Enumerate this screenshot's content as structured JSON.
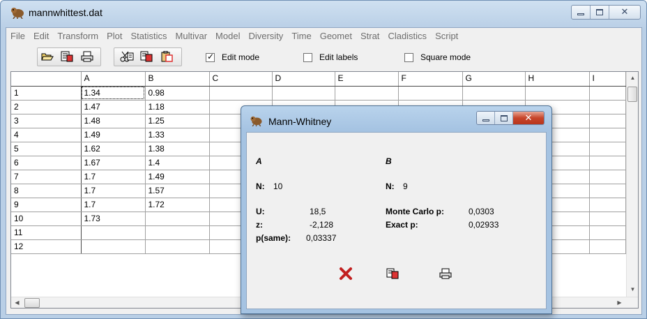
{
  "window": {
    "title": "mannwhittest.dat"
  },
  "menu": [
    "File",
    "Edit",
    "Transform",
    "Plot",
    "Statistics",
    "Multivar",
    "Model",
    "Diversity",
    "Time",
    "Geomet",
    "Strat",
    "Cladistics",
    "Script"
  ],
  "toolbar": {
    "edit_mode": {
      "label": "Edit mode",
      "checked": true
    },
    "edit_labels": {
      "label": "Edit labels",
      "checked": false
    },
    "square_mode": {
      "label": "Square mode",
      "checked": false
    }
  },
  "grid": {
    "columns": [
      "A",
      "B",
      "C",
      "D",
      "E",
      "F",
      "G",
      "H",
      "I"
    ],
    "row_labels": [
      "1",
      "2",
      "3",
      "4",
      "5",
      "6",
      "7",
      "8",
      "9",
      "10",
      "11",
      "12"
    ],
    "col_a": [
      "1.34",
      "1.47",
      "1.48",
      "1.49",
      "1.62",
      "1.67",
      "1.7",
      "1.7",
      "1.7",
      "1.73",
      "",
      ""
    ],
    "col_b": [
      "0.98",
      "1.18",
      "1.25",
      "1.33",
      "1.38",
      "1.4",
      "1.49",
      "1.57",
      "1.72",
      "",
      "",
      ""
    ]
  },
  "dialog": {
    "title": "Mann-Whitney",
    "group_a": "A",
    "group_b": "B",
    "n_label": "N:",
    "n_a": "10",
    "n_b": "9",
    "u_label": "U:",
    "u_value": "18,5",
    "z_label": "z:",
    "z_value": "-2,128",
    "psame_label": "p(same):",
    "psame_value": "0,03337",
    "mc_label": "Monte Carlo p:",
    "mc_value": "0,0303",
    "exact_label": "Exact p:",
    "exact_value": "0,02933"
  },
  "colors": {
    "title_gradient": "#b9cfe6",
    "close_red": "#c7452a",
    "grid_line": "#a0a0a0"
  }
}
